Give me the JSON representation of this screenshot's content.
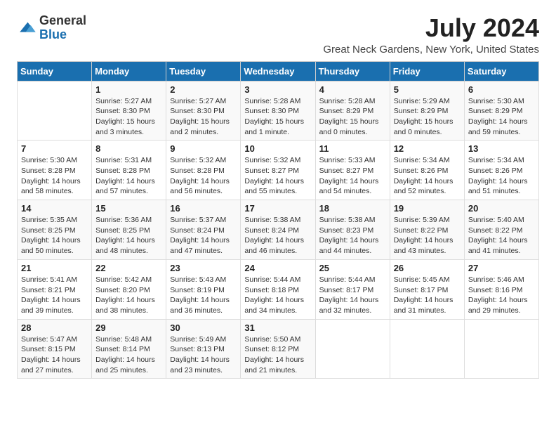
{
  "logo": {
    "general": "General",
    "blue": "Blue"
  },
  "title": "July 2024",
  "location": "Great Neck Gardens, New York, United States",
  "days_of_week": [
    "Sunday",
    "Monday",
    "Tuesday",
    "Wednesday",
    "Thursday",
    "Friday",
    "Saturday"
  ],
  "weeks": [
    [
      {
        "day": "",
        "sunrise": "",
        "sunset": "",
        "daylight": ""
      },
      {
        "day": "1",
        "sunrise": "5:27 AM",
        "sunset": "8:30 PM",
        "daylight": "15 hours and 3 minutes."
      },
      {
        "day": "2",
        "sunrise": "5:27 AM",
        "sunset": "8:30 PM",
        "daylight": "15 hours and 2 minutes."
      },
      {
        "day": "3",
        "sunrise": "5:28 AM",
        "sunset": "8:30 PM",
        "daylight": "15 hours and 1 minute."
      },
      {
        "day": "4",
        "sunrise": "5:28 AM",
        "sunset": "8:29 PM",
        "daylight": "15 hours and 0 minutes."
      },
      {
        "day": "5",
        "sunrise": "5:29 AM",
        "sunset": "8:29 PM",
        "daylight": "15 hours and 0 minutes."
      },
      {
        "day": "6",
        "sunrise": "5:30 AM",
        "sunset": "8:29 PM",
        "daylight": "14 hours and 59 minutes."
      }
    ],
    [
      {
        "day": "7",
        "sunrise": "5:30 AM",
        "sunset": "8:28 PM",
        "daylight": "14 hours and 58 minutes."
      },
      {
        "day": "8",
        "sunrise": "5:31 AM",
        "sunset": "8:28 PM",
        "daylight": "14 hours and 57 minutes."
      },
      {
        "day": "9",
        "sunrise": "5:32 AM",
        "sunset": "8:28 PM",
        "daylight": "14 hours and 56 minutes."
      },
      {
        "day": "10",
        "sunrise": "5:32 AM",
        "sunset": "8:27 PM",
        "daylight": "14 hours and 55 minutes."
      },
      {
        "day": "11",
        "sunrise": "5:33 AM",
        "sunset": "8:27 PM",
        "daylight": "14 hours and 54 minutes."
      },
      {
        "day": "12",
        "sunrise": "5:34 AM",
        "sunset": "8:26 PM",
        "daylight": "14 hours and 52 minutes."
      },
      {
        "day": "13",
        "sunrise": "5:34 AM",
        "sunset": "8:26 PM",
        "daylight": "14 hours and 51 minutes."
      }
    ],
    [
      {
        "day": "14",
        "sunrise": "5:35 AM",
        "sunset": "8:25 PM",
        "daylight": "14 hours and 50 minutes."
      },
      {
        "day": "15",
        "sunrise": "5:36 AM",
        "sunset": "8:25 PM",
        "daylight": "14 hours and 48 minutes."
      },
      {
        "day": "16",
        "sunrise": "5:37 AM",
        "sunset": "8:24 PM",
        "daylight": "14 hours and 47 minutes."
      },
      {
        "day": "17",
        "sunrise": "5:38 AM",
        "sunset": "8:24 PM",
        "daylight": "14 hours and 46 minutes."
      },
      {
        "day": "18",
        "sunrise": "5:38 AM",
        "sunset": "8:23 PM",
        "daylight": "14 hours and 44 minutes."
      },
      {
        "day": "19",
        "sunrise": "5:39 AM",
        "sunset": "8:22 PM",
        "daylight": "14 hours and 43 minutes."
      },
      {
        "day": "20",
        "sunrise": "5:40 AM",
        "sunset": "8:22 PM",
        "daylight": "14 hours and 41 minutes."
      }
    ],
    [
      {
        "day": "21",
        "sunrise": "5:41 AM",
        "sunset": "8:21 PM",
        "daylight": "14 hours and 39 minutes."
      },
      {
        "day": "22",
        "sunrise": "5:42 AM",
        "sunset": "8:20 PM",
        "daylight": "14 hours and 38 minutes."
      },
      {
        "day": "23",
        "sunrise": "5:43 AM",
        "sunset": "8:19 PM",
        "daylight": "14 hours and 36 minutes."
      },
      {
        "day": "24",
        "sunrise": "5:44 AM",
        "sunset": "8:18 PM",
        "daylight": "14 hours and 34 minutes."
      },
      {
        "day": "25",
        "sunrise": "5:44 AM",
        "sunset": "8:17 PM",
        "daylight": "14 hours and 32 minutes."
      },
      {
        "day": "26",
        "sunrise": "5:45 AM",
        "sunset": "8:17 PM",
        "daylight": "14 hours and 31 minutes."
      },
      {
        "day": "27",
        "sunrise": "5:46 AM",
        "sunset": "8:16 PM",
        "daylight": "14 hours and 29 minutes."
      }
    ],
    [
      {
        "day": "28",
        "sunrise": "5:47 AM",
        "sunset": "8:15 PM",
        "daylight": "14 hours and 27 minutes."
      },
      {
        "day": "29",
        "sunrise": "5:48 AM",
        "sunset": "8:14 PM",
        "daylight": "14 hours and 25 minutes."
      },
      {
        "day": "30",
        "sunrise": "5:49 AM",
        "sunset": "8:13 PM",
        "daylight": "14 hours and 23 minutes."
      },
      {
        "day": "31",
        "sunrise": "5:50 AM",
        "sunset": "8:12 PM",
        "daylight": "14 hours and 21 minutes."
      },
      {
        "day": "",
        "sunrise": "",
        "sunset": "",
        "daylight": ""
      },
      {
        "day": "",
        "sunrise": "",
        "sunset": "",
        "daylight": ""
      },
      {
        "day": "",
        "sunrise": "",
        "sunset": "",
        "daylight": ""
      }
    ]
  ]
}
